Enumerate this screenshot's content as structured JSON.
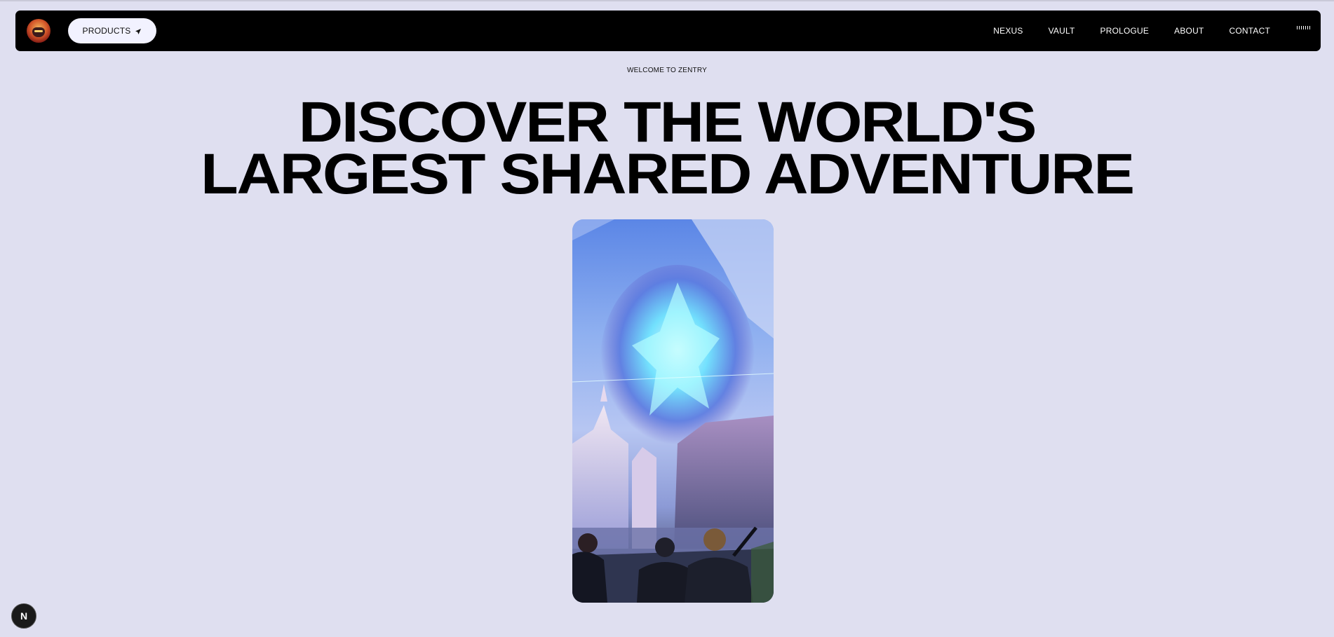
{
  "header": {
    "logo_icon": "zentry-mascot-logo",
    "products_label": "PRODUCTS",
    "products_icon": "paper-plane-icon",
    "nav_items": [
      {
        "label": "NEXUS"
      },
      {
        "label": "VAULT"
      },
      {
        "label": "PROLOGUE"
      },
      {
        "label": "ABOUT"
      },
      {
        "label": "CONTACT"
      }
    ],
    "audio_icon": "audio-bars-icon"
  },
  "hero": {
    "eyebrow": "WELCOME TO ZENTRY",
    "headline_line1": "DISCOVER THE WORLD'S",
    "headline_line2": "LARGEST SHARED ADVENTURE",
    "media_description_icon": "hero-video-thumbnail"
  },
  "badge": {
    "label": "N"
  },
  "colors": {
    "page_background": "#dfdff0",
    "navbar_background": "#000000",
    "button_background": "#f2f2ff",
    "text_primary": "#000000",
    "nav_text": "#ffffff"
  }
}
